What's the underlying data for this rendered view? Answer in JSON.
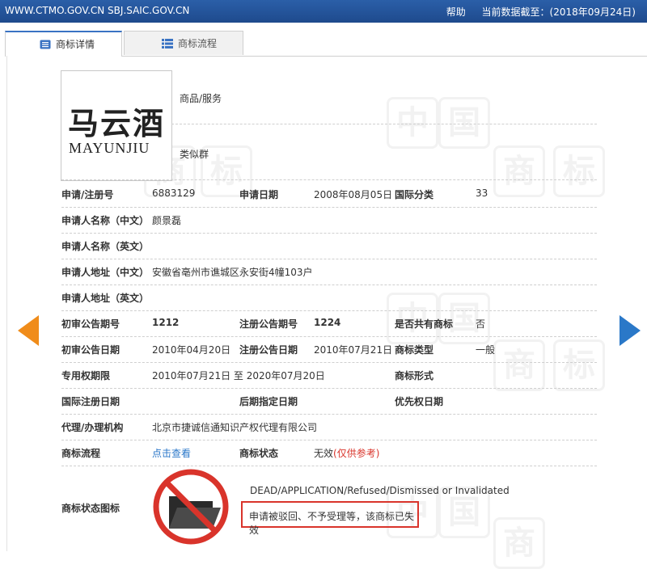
{
  "header": {
    "site": "WWW.CTMO.GOV.CN SBJ.SAIC.GOV.CN",
    "help": "帮助",
    "date_label": "当前数据截至：(2018年09月24日)"
  },
  "tabs": [
    {
      "label": "商标详情",
      "icon": "document-list-icon"
    },
    {
      "label": "商标流程",
      "icon": "list-icon"
    }
  ],
  "watermark": [
    "中",
    "国",
    "商",
    "标"
  ],
  "logo": {
    "chinese": "马云酒",
    "english": "MAYUNJIU"
  },
  "top_fields": {
    "goods_label": "商品/服务",
    "group_label": "类似群"
  },
  "fields": {
    "reg_no_label": "申请/注册号",
    "reg_no": "6883129",
    "app_date_label": "申请日期",
    "app_date": "2008年08月05日",
    "intl_class_label": "国际分类",
    "intl_class": "33",
    "applicant_cn_label": "申请人名称（中文）",
    "applicant_cn": "颜景磊",
    "applicant_en_label": "申请人名称（英文）",
    "applicant_en": "",
    "address_cn_label": "申请人地址（中文）",
    "address_cn": "安徽省亳州市谯城区永安街4幢103户",
    "address_en_label": "申请人地址（英文）",
    "address_en": "",
    "prelim_issue_label": "初审公告期号",
    "prelim_issue": "1212",
    "reg_issue_label": "注册公告期号",
    "reg_issue": "1224",
    "shared_label": "是否共有商标",
    "shared": "否",
    "prelim_date_label": "初审公告日期",
    "prelim_date": "2010年04月20日",
    "reg_date_label": "注册公告日期",
    "reg_date": "2010年07月21日",
    "tm_type_label": "商标类型",
    "tm_type": "一般",
    "exclusive_label": "专用权期限",
    "exclusive": "2010年07月21日 至 2020年07月20日",
    "tm_form_label": "商标形式",
    "tm_form": "",
    "intl_reg_date_label": "国际注册日期",
    "intl_reg_date": "",
    "later_date_label": "后期指定日期",
    "later_date": "",
    "priority_date_label": "优先权日期",
    "priority_date": "",
    "agent_label": "代理/办理机构",
    "agent": "北京市捷诚信通知识产权代理有限公司",
    "flow_label": "商标流程",
    "flow_link": "点击查看",
    "status_label": "商标状态",
    "status": "无效",
    "status_note": "(仅供参考)",
    "status_icon_label": "商标状态图标"
  },
  "status_icon": {
    "icon": "folder-prohibited-icon",
    "caption_en": "DEAD/APPLICATION/Refused/Dismissed or Invalidated",
    "caption_cn": "申请被驳回、不予受理等，该商标已失效"
  },
  "colors": {
    "header_blue": "#1e4a8d",
    "red": "#d9342b",
    "orange": "#f08c1a",
    "link_blue": "#2a77c9"
  }
}
